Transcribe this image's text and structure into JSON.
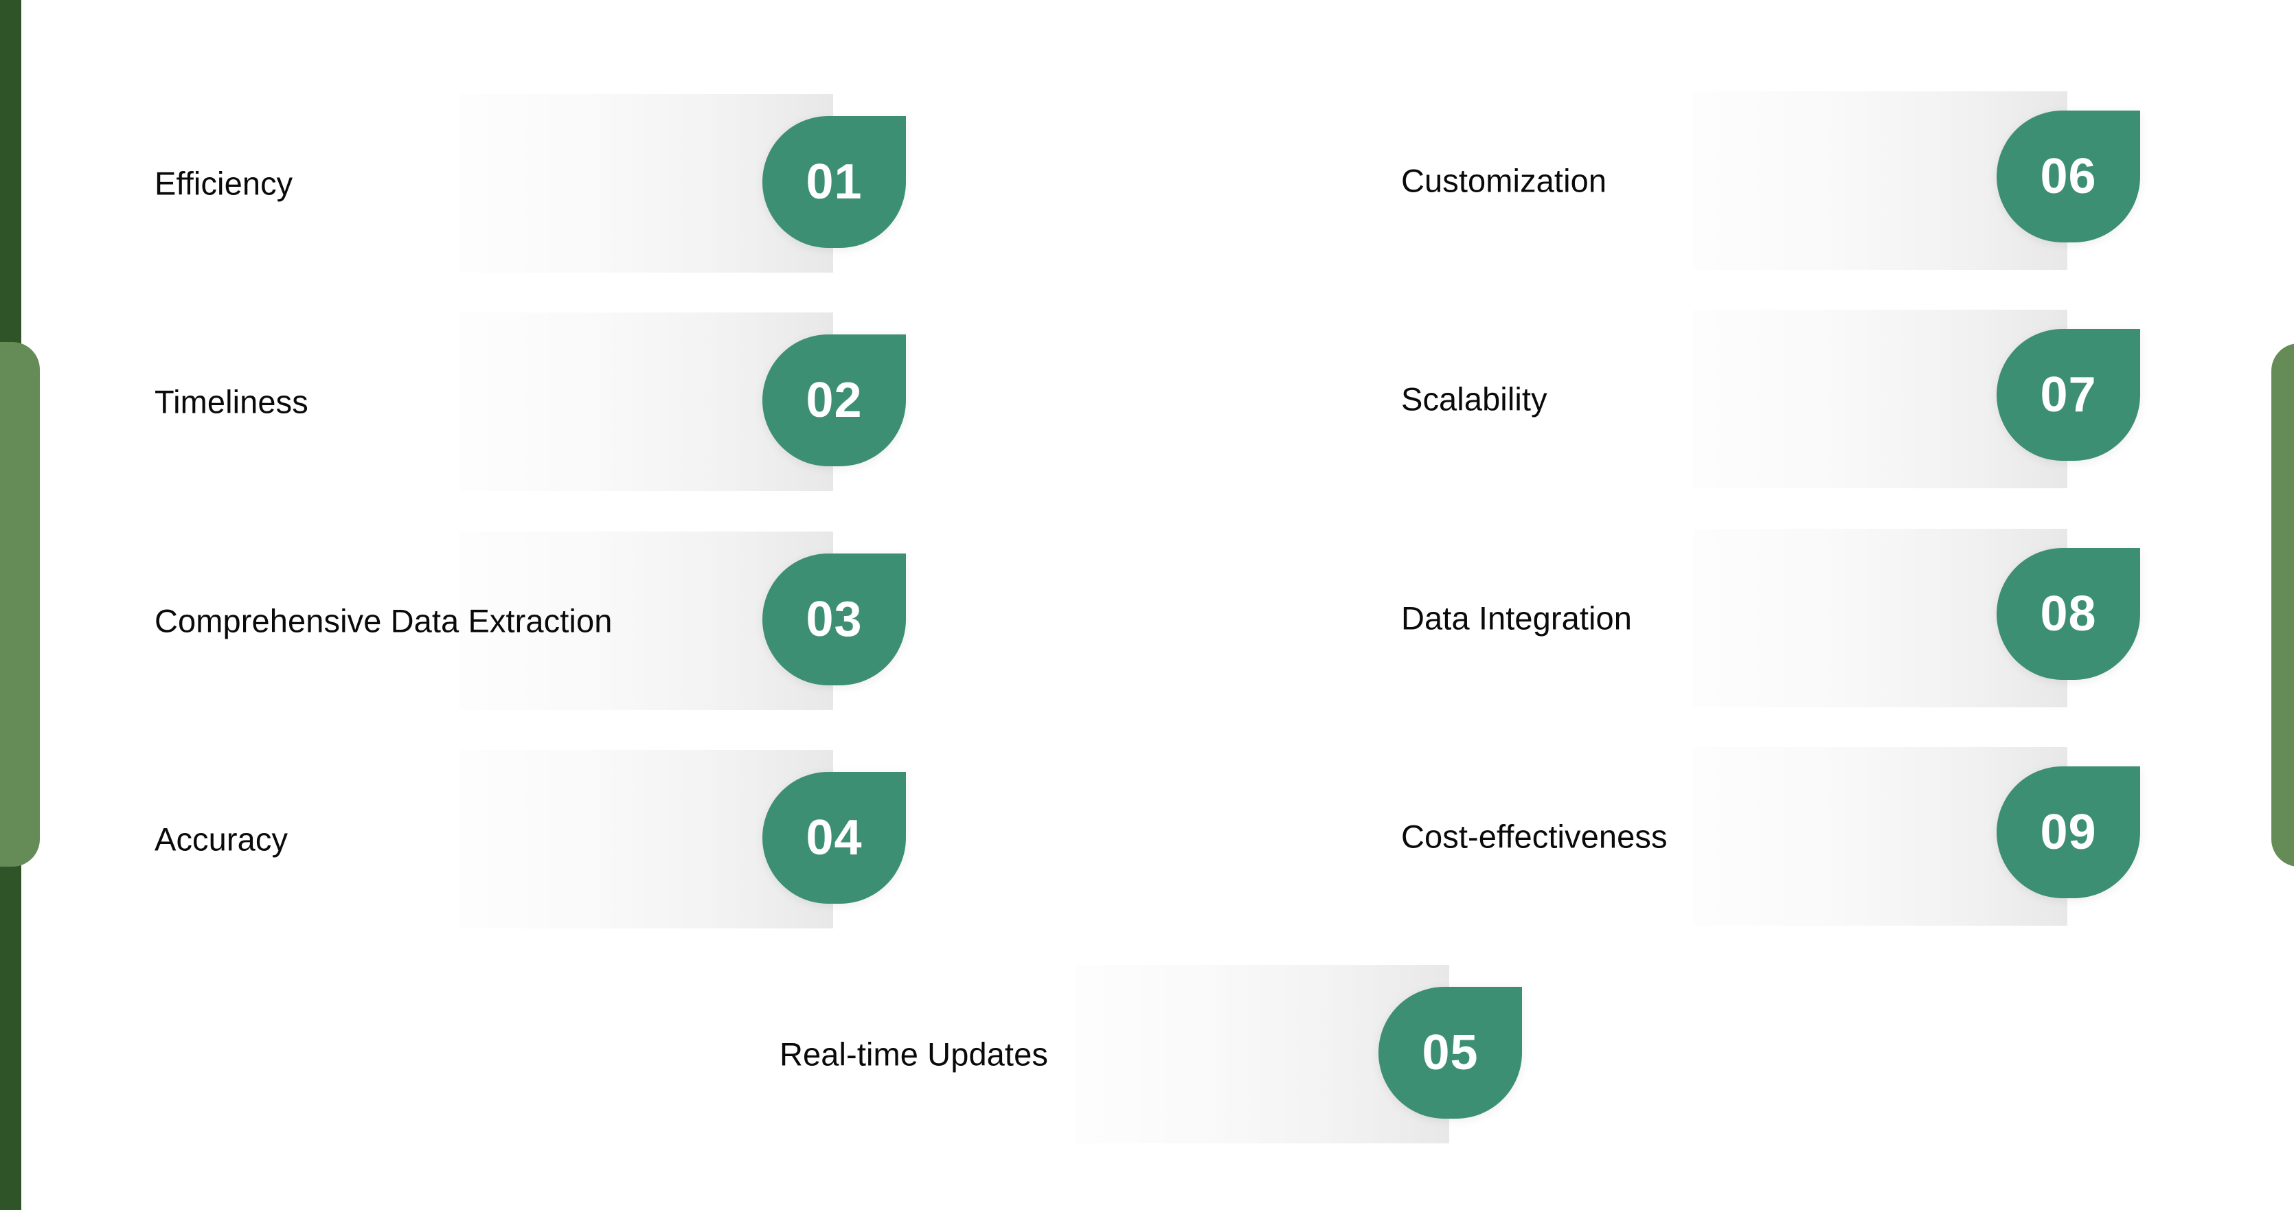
{
  "theme": {
    "badge_green": "#3d8f73",
    "edge_dark_green": "#2e5427",
    "edge_light_green": "#658c57",
    "bar_gradient_start": "#fbfbfb",
    "bar_gradient_end": "#e8e8e8",
    "label_color": "#0a0a0a",
    "badge_text_color": "#ffffff",
    "background": "#ffffff"
  },
  "columns": {
    "left": {
      "items": [
        {
          "number": "01",
          "label": "Efficiency"
        },
        {
          "number": "02",
          "label": "Timeliness"
        },
        {
          "number": "03",
          "label": "Comprehensive Data Extraction"
        },
        {
          "number": "04",
          "label": "Accuracy"
        }
      ]
    },
    "right": {
      "items": [
        {
          "number": "06",
          "label": "Customization"
        },
        {
          "number": "07",
          "label": "Scalability"
        },
        {
          "number": "08",
          "label": "Data Integration"
        },
        {
          "number": "09",
          "label": "Cost-effectiveness"
        }
      ]
    },
    "center": {
      "items": [
        {
          "number": "05",
          "label": "Real-time Updates"
        }
      ]
    }
  }
}
